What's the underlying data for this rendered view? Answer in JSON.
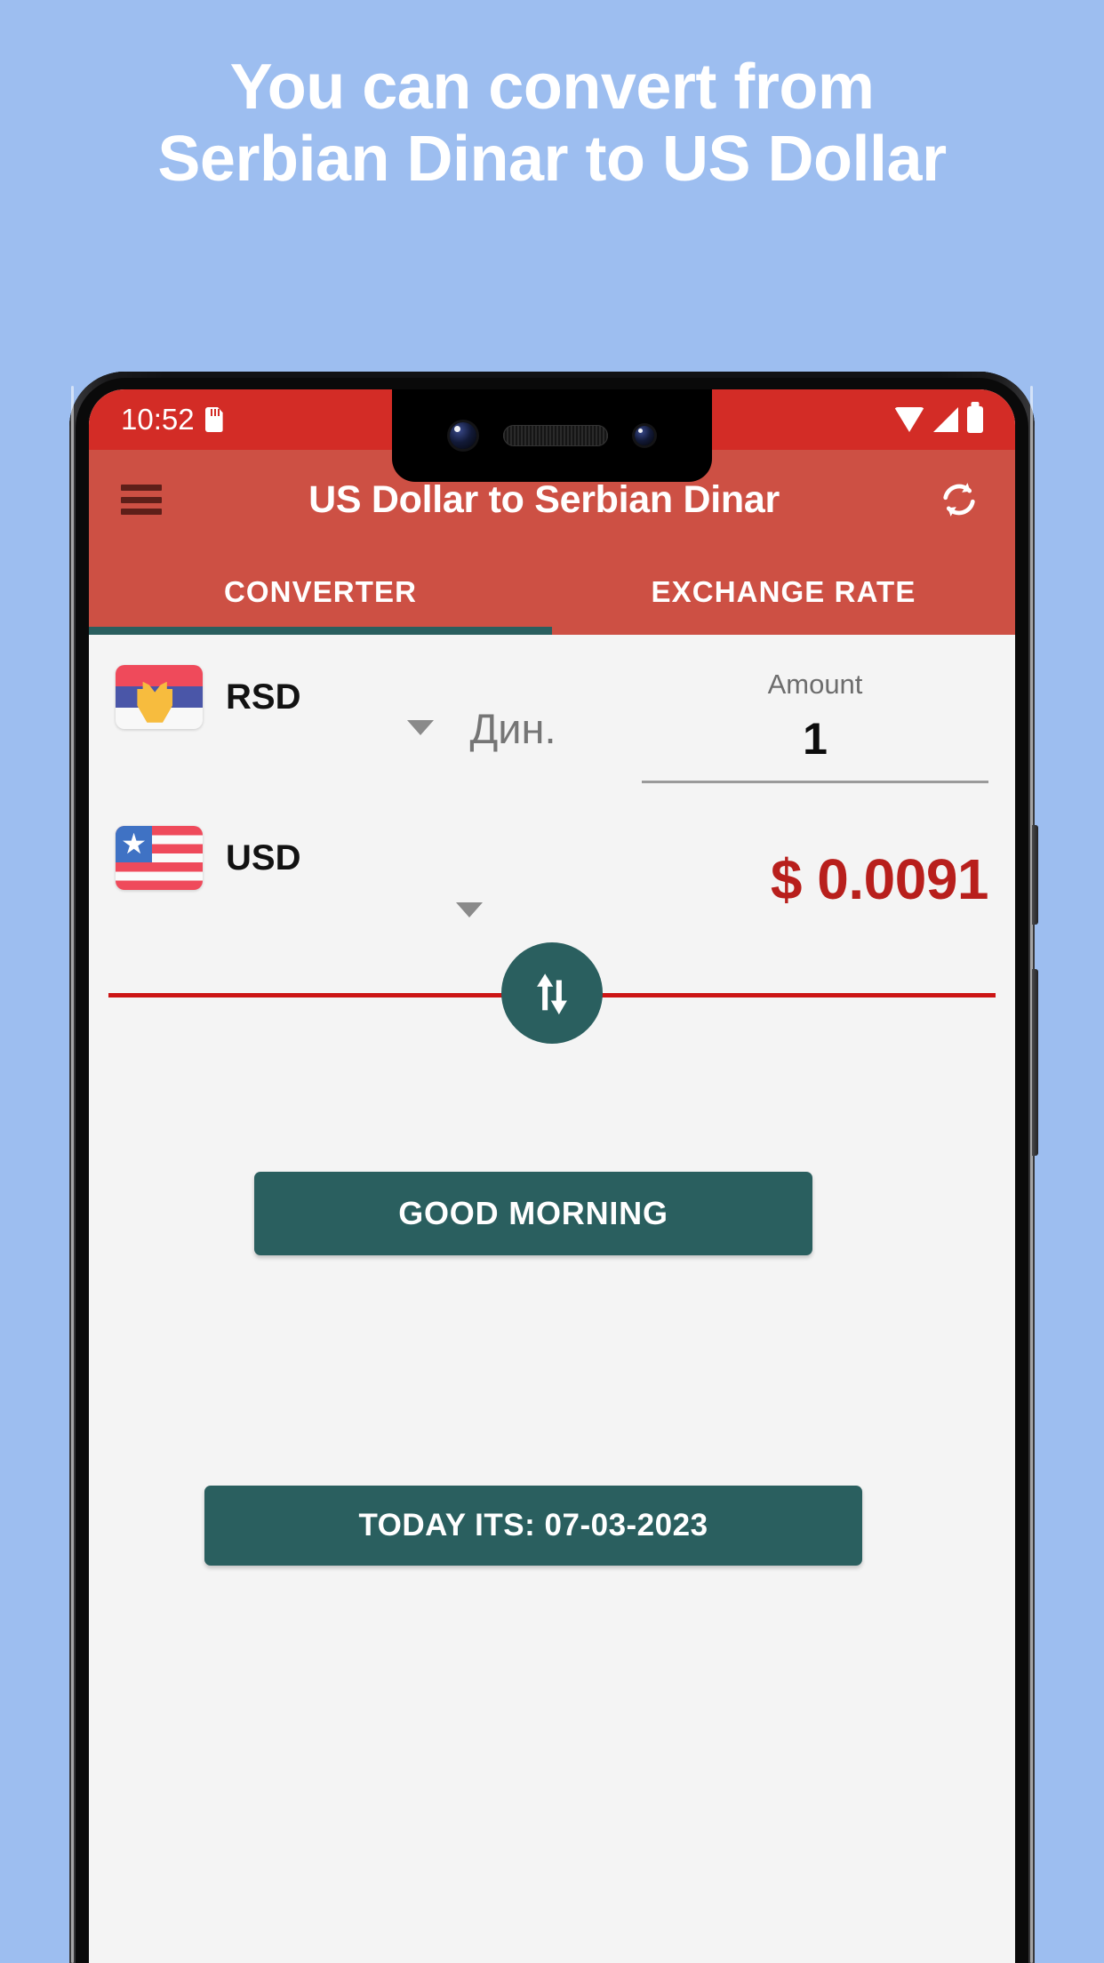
{
  "promo": {
    "line1": "You can convert from",
    "line2": "Serbian Dinar to US Dollar",
    "background_color": "#9dbef0",
    "text_color": "#ffffff"
  },
  "statusbar": {
    "time": "10:52",
    "icons": [
      "sd-card-icon",
      "wifi-icon",
      "signal-icon",
      "battery-icon"
    ],
    "background_color": "#d32c26"
  },
  "appbar": {
    "menu_icon": "hamburger-menu-icon",
    "title": "US Dollar to Serbian Dinar",
    "refresh_icon": "refresh-icon",
    "background_color": "#cd5044"
  },
  "tabs": {
    "items": [
      {
        "label": "CONVERTER",
        "active": true
      },
      {
        "label": "EXCHANGE RATE",
        "active": false
      }
    ],
    "indicator_color": "#2a5f5f"
  },
  "converter": {
    "from": {
      "flag": "serbia-flag-icon",
      "code": "RSD",
      "symbol": "Дин.",
      "amount_label": "Amount",
      "amount_value": "1"
    },
    "to": {
      "flag": "usa-flag-icon",
      "code": "USD",
      "result": "$ 0.0091",
      "result_color": "#b81f1c"
    },
    "swap_icon": "swap-vertical-icon",
    "divider_color": "#cc1515"
  },
  "buttons": {
    "greeting": "GOOD MORNING",
    "today": "TODAY ITS: 07-03-2023",
    "color": "#2a5f5f"
  }
}
